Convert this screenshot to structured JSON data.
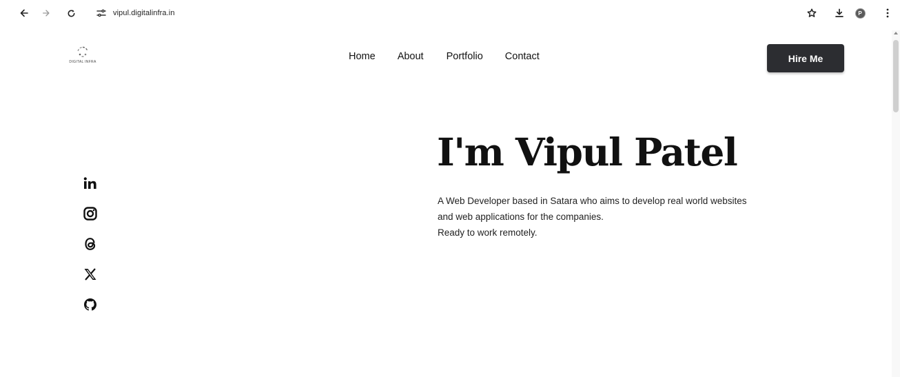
{
  "browser": {
    "url": "vipul.digitalinfra.in",
    "profile_initial": "P",
    "icons": [
      "back-arrow-icon",
      "forward-arrow-icon",
      "reload-icon",
      "site-settings-icon",
      "star-icon",
      "download-icon",
      "profile-avatar",
      "kebab-menu-icon"
    ]
  },
  "site": {
    "logo_text": "DIGITAL INFRA",
    "nav": {
      "home": "Home",
      "about": "About",
      "portfolio": "Portfolio",
      "contact": "Contact"
    },
    "cta": "Hire Me"
  },
  "socials": [
    "linkedin",
    "instagram",
    "threads",
    "x",
    "github"
  ],
  "hero": {
    "title": "I'm Vipul Patel",
    "line1": "A Web Developer based in Satara who aims to develop real world websites",
    "line2": "and web applications for the companies.",
    "line3": "Ready to work remotely."
  },
  "colors": {
    "button_bg": "#2c2d31",
    "text": "#111111",
    "background": "#ffffff"
  }
}
